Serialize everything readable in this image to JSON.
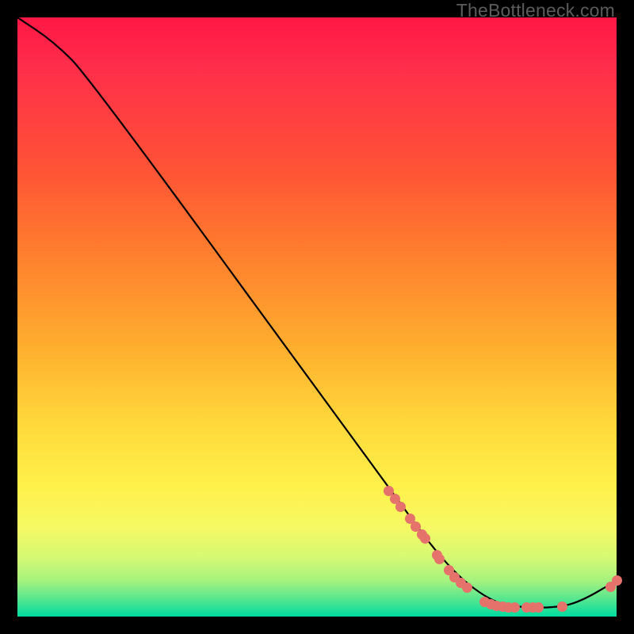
{
  "watermark": "TheBottleneck.com",
  "colors": {
    "marker": "#e5726b",
    "curve": "#000000",
    "grad_top": "#ff1744",
    "grad_mid": "#ffd93b",
    "grad_bottom": "#00dd9f"
  },
  "chart_data": {
    "type": "line",
    "title": "",
    "xlabel": "",
    "ylabel": "",
    "xlim": [
      0,
      100
    ],
    "ylim": [
      0,
      100
    ],
    "grid": false,
    "curve": [
      {
        "x": 0,
        "y": 100
      },
      {
        "x": 6,
        "y": 96
      },
      {
        "x": 12,
        "y": 90
      },
      {
        "x": 63,
        "y": 20
      },
      {
        "x": 72,
        "y": 8
      },
      {
        "x": 79,
        "y": 2.5
      },
      {
        "x": 84,
        "y": 1.5
      },
      {
        "x": 90,
        "y": 1.5
      },
      {
        "x": 94,
        "y": 2.5
      },
      {
        "x": 100,
        "y": 6
      }
    ],
    "markers": [
      {
        "x": 62,
        "y": 21.0
      },
      {
        "x": 63,
        "y": 19.6
      },
      {
        "x": 64,
        "y": 18.3
      },
      {
        "x": 65.5,
        "y": 16.3
      },
      {
        "x": 66.5,
        "y": 15.0
      },
      {
        "x": 67.5,
        "y": 13.7
      },
      {
        "x": 68,
        "y": 13.0
      },
      {
        "x": 70,
        "y": 10.3
      },
      {
        "x": 70.5,
        "y": 9.6
      },
      {
        "x": 72,
        "y": 7.7
      },
      {
        "x": 73,
        "y": 6.6
      },
      {
        "x": 74,
        "y": 5.6
      },
      {
        "x": 75,
        "y": 4.8
      },
      {
        "x": 78,
        "y": 2.5
      },
      {
        "x": 79,
        "y": 2.1
      },
      {
        "x": 80,
        "y": 1.8
      },
      {
        "x": 81,
        "y": 1.6
      },
      {
        "x": 82,
        "y": 1.55
      },
      {
        "x": 83,
        "y": 1.5
      },
      {
        "x": 85,
        "y": 1.5
      },
      {
        "x": 86,
        "y": 1.5
      },
      {
        "x": 87,
        "y": 1.5
      },
      {
        "x": 91,
        "y": 1.7
      },
      {
        "x": 99,
        "y": 5.0
      },
      {
        "x": 100,
        "y": 6.0
      }
    ]
  }
}
